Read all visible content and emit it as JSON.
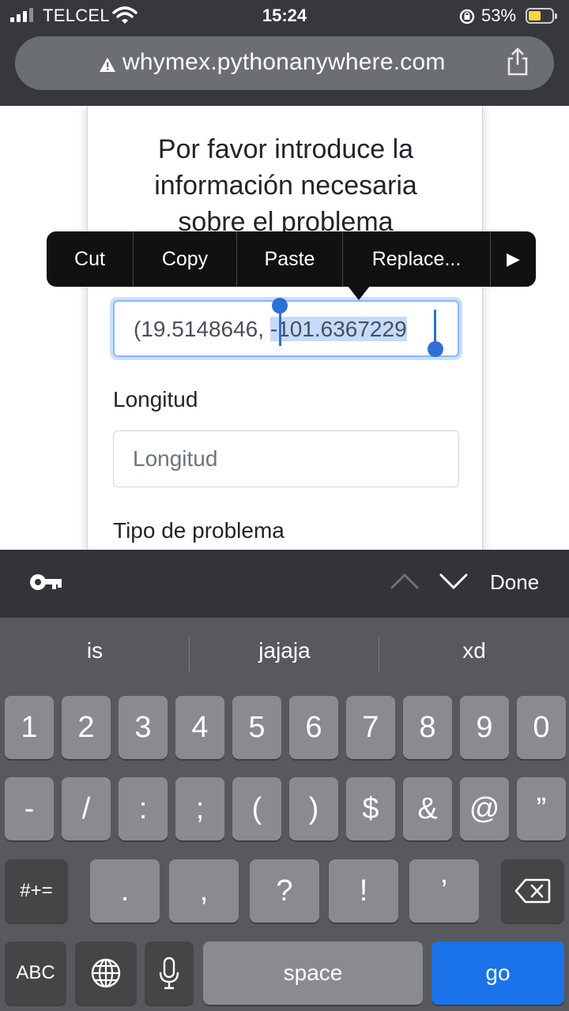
{
  "status_bar": {
    "carrier": "TELCEL",
    "time": "15:24",
    "battery_percent": "53%",
    "battery_level": 0.53,
    "battery_color": "#f5d547"
  },
  "browser": {
    "url": "whymex.pythonanywhere.com",
    "icons": [
      "warning-icon",
      "share-icon"
    ]
  },
  "form": {
    "heading_lines": [
      "Por favor introduce la",
      "información necesaria",
      "sobre el problema"
    ],
    "location_value_unselected": "(19.5148646, ",
    "location_value_selected": "-101.6367229",
    "longitude_label": "Longitud",
    "longitude_placeholder": "Longitud",
    "problem_type_label": "Tipo de problema"
  },
  "edit_menu": {
    "items": [
      "Cut",
      "Copy",
      "Paste",
      "Replace..."
    ],
    "more_arrow": "▶"
  },
  "keyboard_accessory": {
    "done_label": "Done",
    "icons": [
      "key-icon",
      "chevron-up-icon",
      "chevron-down-icon"
    ]
  },
  "keyboard": {
    "suggestions": [
      "is",
      "jajaja",
      "xd"
    ],
    "row1": [
      "1",
      "2",
      "3",
      "4",
      "5",
      "6",
      "7",
      "8",
      "9",
      "0"
    ],
    "row2": [
      "-",
      "/",
      ":",
      ";",
      "(",
      ")",
      "$",
      "&",
      "@",
      "”"
    ],
    "row3": [
      ".",
      ",",
      "?",
      "!",
      "’"
    ],
    "shift_label": "#+=",
    "abc_label": "ABC",
    "space_label": "space",
    "go_label": "go",
    "accent_color": "#1a73e8"
  }
}
